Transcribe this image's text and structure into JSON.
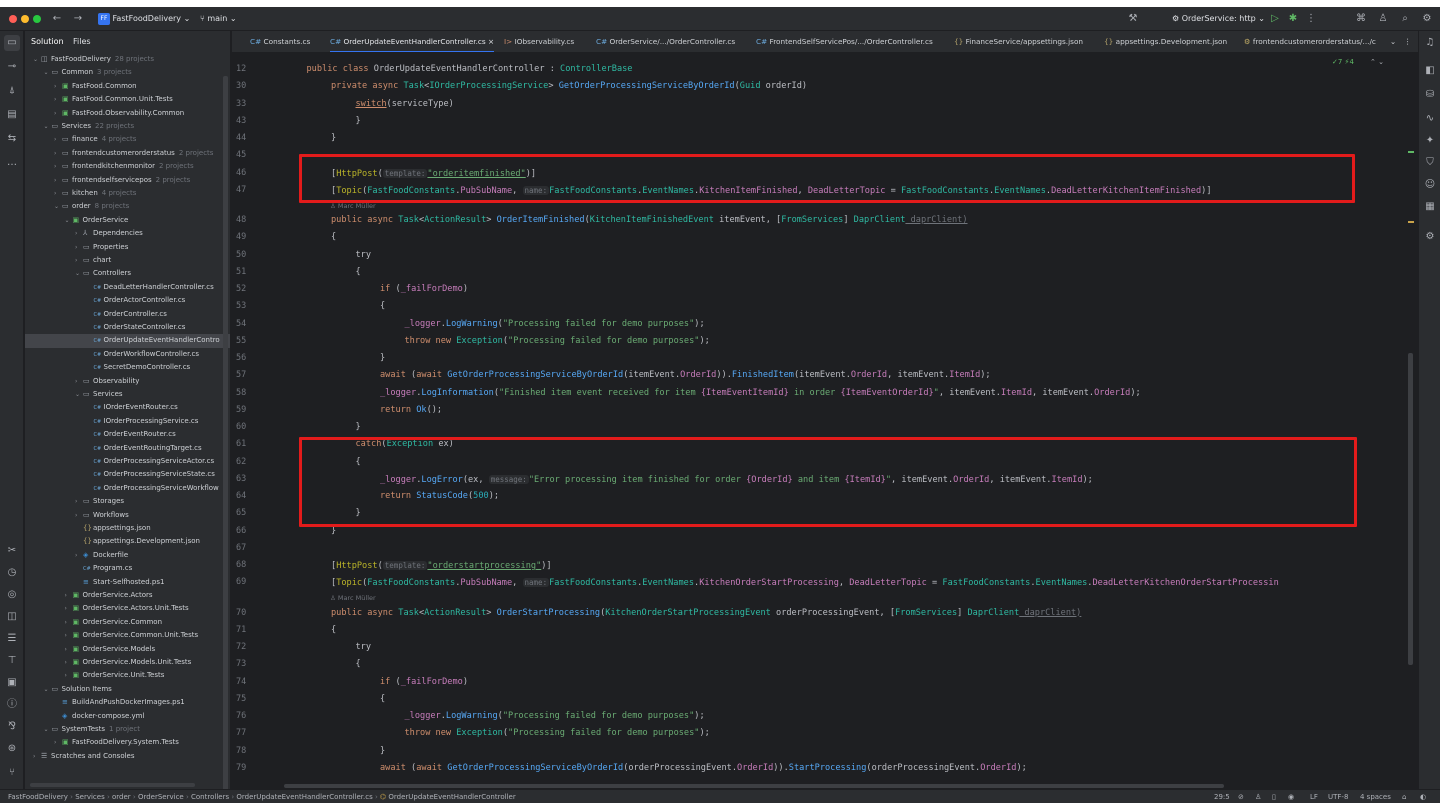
{
  "titlebar": {
    "project": "FastFoodDelivery",
    "branch": "main",
    "run_config": "OrderService: http",
    "colors": {
      "close": "#ff5f57",
      "min": "#febc2e",
      "max": "#28c840",
      "project_badge": "#3574f0"
    }
  },
  "solution_panel": {
    "tabs": [
      "Solution",
      "Files"
    ],
    "tree": [
      {
        "label": "FastFoodDelivery",
        "count": "28 projects",
        "depth": 0,
        "arrow": "⌄",
        "icon": "solution-icon"
      },
      {
        "label": "Common",
        "count": "3 projects",
        "depth": 1,
        "arrow": "⌄",
        "icon": "folder-icon"
      },
      {
        "label": "FastFood.Common",
        "count": "",
        "depth": 2,
        "arrow": "›",
        "icon": "project-icon"
      },
      {
        "label": "FastFood.Common.Unit.Tests",
        "count": "",
        "depth": 2,
        "arrow": "›",
        "icon": "test-project-icon"
      },
      {
        "label": "FastFood.Observability.Common",
        "count": "",
        "depth": 2,
        "arrow": "›",
        "icon": "project-icon"
      },
      {
        "label": "Services",
        "count": "22 projects",
        "depth": 1,
        "arrow": "⌄",
        "icon": "folder-icon"
      },
      {
        "label": "finance",
        "count": "4 projects",
        "depth": 2,
        "arrow": "›",
        "icon": "folder-icon"
      },
      {
        "label": "frontendcustomerorderstatus",
        "count": "2 projects",
        "depth": 2,
        "arrow": "›",
        "icon": "folder-icon"
      },
      {
        "label": "frontendkitchenmonitor",
        "count": "2 projects",
        "depth": 2,
        "arrow": "›",
        "icon": "folder-icon"
      },
      {
        "label": "frontendselfservicepos",
        "count": "2 projects",
        "depth": 2,
        "arrow": "›",
        "icon": "folder-icon"
      },
      {
        "label": "kitchen",
        "count": "4 projects",
        "depth": 2,
        "arrow": "›",
        "icon": "folder-icon"
      },
      {
        "label": "order",
        "count": "8 projects",
        "depth": 2,
        "arrow": "⌄",
        "icon": "folder-icon"
      },
      {
        "label": "OrderService",
        "count": "",
        "depth": 3,
        "arrow": "⌄",
        "icon": "project-icon"
      },
      {
        "label": "Dependencies",
        "count": "",
        "depth": 4,
        "arrow": "›",
        "icon": "dependencies-icon"
      },
      {
        "label": "Properties",
        "count": "",
        "depth": 4,
        "arrow": "›",
        "icon": "folder-icon"
      },
      {
        "label": "chart",
        "count": "",
        "depth": 4,
        "arrow": "›",
        "icon": "folder-icon"
      },
      {
        "label": "Controllers",
        "count": "",
        "depth": 4,
        "arrow": "⌄",
        "icon": "folder-icon"
      },
      {
        "label": "DeadLetterHandlerController.cs",
        "count": "",
        "depth": 5,
        "arrow": "",
        "icon": "csharp-file-icon"
      },
      {
        "label": "OrderActorController.cs",
        "count": "",
        "depth": 5,
        "arrow": "",
        "icon": "csharp-file-icon"
      },
      {
        "label": "OrderController.cs",
        "count": "",
        "depth": 5,
        "arrow": "",
        "icon": "csharp-file-icon"
      },
      {
        "label": "OrderStateController.cs",
        "count": "",
        "depth": 5,
        "arrow": "",
        "icon": "csharp-file-icon"
      },
      {
        "label": "OrderUpdateEventHandlerContro",
        "count": "",
        "depth": 5,
        "arrow": "",
        "icon": "csharp-file-icon",
        "selected": true
      },
      {
        "label": "OrderWorkflowController.cs",
        "count": "",
        "depth": 5,
        "arrow": "",
        "icon": "csharp-file-icon"
      },
      {
        "label": "SecretDemoController.cs",
        "count": "",
        "depth": 5,
        "arrow": "",
        "icon": "csharp-file-icon"
      },
      {
        "label": "Observability",
        "count": "",
        "depth": 4,
        "arrow": "›",
        "icon": "folder-icon"
      },
      {
        "label": "Services",
        "count": "",
        "depth": 4,
        "arrow": "⌄",
        "icon": "folder-icon"
      },
      {
        "label": "IOrderEventRouter.cs",
        "count": "",
        "depth": 5,
        "arrow": "",
        "icon": "csharp-file-icon"
      },
      {
        "label": "IOrderProcessingService.cs",
        "count": "",
        "depth": 5,
        "arrow": "",
        "icon": "csharp-file-icon"
      },
      {
        "label": "OrderEventRouter.cs",
        "count": "",
        "depth": 5,
        "arrow": "",
        "icon": "csharp-file-icon"
      },
      {
        "label": "OrderEventRoutingTarget.cs",
        "count": "",
        "depth": 5,
        "arrow": "",
        "icon": "csharp-file-icon"
      },
      {
        "label": "OrderProcessingServiceActor.cs",
        "count": "",
        "depth": 5,
        "arrow": "",
        "icon": "csharp-file-icon"
      },
      {
        "label": "OrderProcessingServiceState.cs",
        "count": "",
        "depth": 5,
        "arrow": "",
        "icon": "csharp-file-icon"
      },
      {
        "label": "OrderProcessingServiceWorkflow",
        "count": "",
        "depth": 5,
        "arrow": "",
        "icon": "csharp-file-icon"
      },
      {
        "label": "Storages",
        "count": "",
        "depth": 4,
        "arrow": "›",
        "icon": "folder-icon"
      },
      {
        "label": "Workflows",
        "count": "",
        "depth": 4,
        "arrow": "›",
        "icon": "folder-icon"
      },
      {
        "label": "appsettings.json",
        "count": "",
        "depth": 4,
        "arrow": "",
        "icon": "json-file-icon"
      },
      {
        "label": "appsettings.Development.json",
        "count": "",
        "depth": 4,
        "arrow": "",
        "icon": "json-file-icon"
      },
      {
        "label": "Dockerfile",
        "count": "",
        "depth": 4,
        "arrow": "›",
        "icon": "docker-icon"
      },
      {
        "label": "Program.cs",
        "count": "",
        "depth": 4,
        "arrow": "",
        "icon": "csharp-file-icon"
      },
      {
        "label": "Start-Selfhosted.ps1",
        "count": "",
        "depth": 4,
        "arrow": "",
        "icon": "script-icon"
      },
      {
        "label": "OrderService.Actors",
        "count": "",
        "depth": 3,
        "arrow": "›",
        "icon": "project-icon"
      },
      {
        "label": "OrderService.Actors.Unit.Tests",
        "count": "",
        "depth": 3,
        "arrow": "›",
        "icon": "test-project-icon"
      },
      {
        "label": "OrderService.Common",
        "count": "",
        "depth": 3,
        "arrow": "›",
        "icon": "project-icon"
      },
      {
        "label": "OrderService.Common.Unit.Tests",
        "count": "",
        "depth": 3,
        "arrow": "›",
        "icon": "test-project-icon"
      },
      {
        "label": "OrderService.Models",
        "count": "",
        "depth": 3,
        "arrow": "›",
        "icon": "project-icon"
      },
      {
        "label": "OrderService.Models.Unit.Tests",
        "count": "",
        "depth": 3,
        "arrow": "›",
        "icon": "test-project-icon"
      },
      {
        "label": "OrderService.Unit.Tests",
        "count": "",
        "depth": 3,
        "arrow": "›",
        "icon": "test-project-icon"
      },
      {
        "label": "Solution Items",
        "count": "",
        "depth": 1,
        "arrow": "⌄",
        "icon": "folder-icon"
      },
      {
        "label": "BuildAndPushDockerImages.ps1",
        "count": "",
        "depth": 2,
        "arrow": "",
        "icon": "script-icon"
      },
      {
        "label": "docker-compose.yml",
        "count": "",
        "depth": 2,
        "arrow": "",
        "icon": "docker-icon"
      },
      {
        "label": "SystemTests",
        "count": "1 project",
        "depth": 1,
        "arrow": "⌄",
        "icon": "folder-icon"
      },
      {
        "label": "FastFoodDelivery.System.Tests",
        "count": "",
        "depth": 2,
        "arrow": "›",
        "icon": "test-project-icon"
      },
      {
        "label": "Scratches and Consoles",
        "count": "",
        "depth": 0,
        "arrow": "›",
        "icon": "scratches-icon"
      }
    ]
  },
  "editor_tabs": [
    {
      "label": "Constants.cs",
      "icon": "C#"
    },
    {
      "label": "OrderUpdateEventHandlerController.cs",
      "icon": "C#",
      "active": true,
      "close": "×"
    },
    {
      "label": "IObservability.cs",
      "icon": "I>"
    },
    {
      "label": "OrderService/.../OrderController.cs",
      "icon": "C#"
    },
    {
      "label": "FrontendSelfServicePos/.../OrderController.cs",
      "icon": "C#"
    },
    {
      "label": "FinanceService/appsettings.json",
      "icon": "{}"
    },
    {
      "label": "appsettings.Development.json",
      "icon": "{}"
    },
    {
      "label": "frontendcustomerorderstatus/.../c",
      "icon": "⚙"
    }
  ],
  "inspection": "✓7 ⚡4",
  "line_numbers": [
    "12",
    "30",
    "33",
    "43",
    "44",
    "45",
    "46",
    "47",
    "",
    "48",
    "49",
    "50",
    "51",
    "52",
    "53",
    "54",
    "55",
    "56",
    "57",
    "58",
    "59",
    "60",
    "61",
    "62",
    "63",
    "64",
    "65",
    "66",
    "67",
    "68",
    "69",
    "",
    "70",
    "71",
    "72",
    "73",
    "74",
    "75",
    "76",
    "77",
    "78",
    "79"
  ],
  "code": {
    "l12": [
      "public class ",
      "OrderUpdateEventHandlerController",
      " : ",
      "ControllerBase"
    ],
    "l30": [
      "private async ",
      "Task",
      "<",
      "IOrderProcessingService",
      "> ",
      "GetOrderProcessingServiceByOrderId",
      "(",
      "Guid",
      " orderId)"
    ],
    "l33": [
      "switch",
      "(serviceType)"
    ],
    "l43": "}",
    "l44": "}",
    "l46": [
      "[",
      "HttpPost",
      "(",
      "template:",
      "\"orderitemfinished\"",
      ")]"
    ],
    "l47": [
      "[",
      "Topic",
      "(",
      "FastFoodConstants",
      ".",
      "PubSubName",
      ", ",
      "name:",
      "FastFoodConstants",
      ".",
      "EventNames",
      ".",
      "KitchenItemFinished",
      ", ",
      "DeadLetterTopic",
      " = ",
      "FastFoodConstants",
      ".",
      "EventNames",
      ".",
      "DeadLetterKitchenItemFinished",
      ")]"
    ],
    "author1": "Marc Müller",
    "l48": [
      "public async ",
      "Task",
      "<",
      "ActionResult",
      "> ",
      "OrderItemFinished",
      "(",
      "KitchenItemFinishedEvent",
      " itemEvent, [",
      "FromServices",
      "] ",
      "DaprClient",
      " daprClient)"
    ],
    "l49": "{",
    "l50": "try",
    "l51": "{",
    "l52": [
      "if",
      " (",
      "_failForDemo",
      ")"
    ],
    "l53": "{",
    "l54": [
      "_logger",
      ".",
      "LogWarning",
      "(",
      "\"Processing failed for demo purposes\"",
      ");"
    ],
    "l55": [
      "throw new ",
      "Exception",
      "(",
      "\"Processing failed for demo purposes\"",
      ");"
    ],
    "l56": "}",
    "l57": [
      "await",
      " (",
      "await ",
      "GetOrderProcessingServiceByOrderId",
      "(itemEvent.",
      "OrderId",
      ")).",
      "FinishedItem",
      "(itemEvent.",
      "OrderId",
      ", itemEvent.",
      "ItemId",
      ");"
    ],
    "l58": [
      "_logger",
      ".",
      "LogInformation",
      "(",
      "\"Finished item event received for item ",
      "{ItemEventItemId}",
      " in order ",
      "{ItemEventOrderId}",
      "\"",
      ", itemEvent.",
      "ItemId",
      ", itemEvent.",
      "OrderId",
      ");"
    ],
    "l59": [
      "return ",
      "Ok",
      "();"
    ],
    "l60": "}",
    "l61": [
      "catch",
      "(",
      "Exception",
      " ex)"
    ],
    "l62": "{",
    "l63": [
      "_logger",
      ".",
      "LogError",
      "(ex, ",
      "message:",
      "\"Error processing item finished for order ",
      "{OrderId}",
      " and item ",
      "{ItemId}",
      "\"",
      ", itemEvent.",
      "OrderId",
      ", itemEvent.",
      "ItemId",
      ");"
    ],
    "l64": [
      "return ",
      "StatusCode",
      "(",
      "500",
      ");"
    ],
    "l65": "}",
    "l66": "}",
    "l68": [
      "[",
      "HttpPost",
      "(",
      "template:",
      "\"orderstartprocessing\"",
      ")]"
    ],
    "l69": [
      "[",
      "Topic",
      "(",
      "FastFoodConstants",
      ".",
      "PubSubName",
      ", ",
      "name:",
      "FastFoodConstants",
      ".",
      "EventNames",
      ".",
      "KitchenOrderStartProcessing",
      ", ",
      "DeadLetterTopic",
      " = ",
      "FastFoodConstants",
      ".",
      "EventNames",
      ".",
      "DeadLetterKitchenOrderStartProcessin"
    ],
    "author2": "Marc Müller",
    "l70": [
      "public async ",
      "Task",
      "<",
      "ActionResult",
      "> ",
      "OrderStartProcessing",
      "(",
      "KitchenOrderStartProcessingEvent",
      " orderProcessingEvent, [",
      "FromServices",
      "] ",
      "DaprClient",
      " daprClient)"
    ],
    "l71": "{",
    "l72": "try",
    "l73": "{",
    "l74": [
      "if",
      " (",
      "_failForDemo",
      ")"
    ],
    "l75": "{",
    "l76": [
      "_logger",
      ".",
      "LogWarning",
      "(",
      "\"Processing failed for demo purposes\"",
      ");"
    ],
    "l77": [
      "throw new ",
      "Exception",
      "(",
      "\"Processing failed for demo purposes\"",
      ");"
    ],
    "l78": "}",
    "l79": [
      "await",
      " (",
      "await ",
      "GetOrderProcessingServiceByOrderId",
      "(orderProcessingEvent.",
      "OrderId",
      ")).",
      "StartProcessing",
      "(orderProcessingEvent.",
      "OrderId",
      ");"
    ]
  },
  "statusbar": {
    "breadcrumb": [
      "FastFoodDelivery",
      "Services",
      "order",
      "OrderService",
      "Controllers",
      "OrderUpdateEventHandlerController.cs",
      "OrderUpdateEventHandlerController"
    ],
    "position": "29:5",
    "line_ending": "LF",
    "encoding": "UTF-8",
    "indent": "4 spaces"
  },
  "annotation_color": "#e31b1b"
}
